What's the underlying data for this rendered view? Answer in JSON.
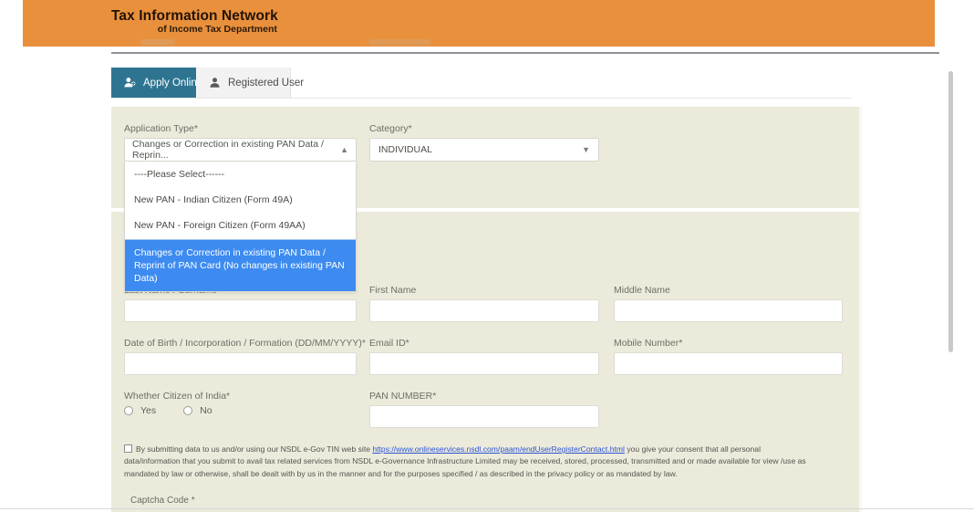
{
  "header": {
    "brand_line1": "Tax Information Network",
    "brand_line2": "of Income Tax Department",
    "background_color": "#e8903c"
  },
  "tabs": [
    {
      "label": "Apply Online",
      "icon": "user-add-icon",
      "active": true,
      "active_color": "#2e7491"
    },
    {
      "label": "Registered User",
      "icon": "user-icon",
      "active": false
    }
  ],
  "form": {
    "application_type": {
      "label": "Application Type*",
      "selected": "Changes or Correction in existing PAN Data / Reprin...",
      "expanded": true,
      "options": [
        "----Please Select------",
        "New PAN - Indian Citizen (Form 49A)",
        "New PAN - Foreign Citizen (Form 49AA)",
        "Changes or Correction in existing PAN Data / Reprint of PAN Card (No changes in existing PAN Data)"
      ],
      "highlighted_index": 3,
      "highlight_color": "#3d8bf0"
    },
    "category": {
      "label": "Category*",
      "selected": "INDIVIDUAL"
    },
    "last_name": {
      "label": "Last Name / Surname*",
      "value": ""
    },
    "first_name": {
      "label": "First Name",
      "value": ""
    },
    "middle_name": {
      "label": "Middle Name",
      "value": ""
    },
    "dob": {
      "label": "Date of Birth / Incorporation / Formation (DD/MM/YYYY)*",
      "value": ""
    },
    "email": {
      "label": "Email ID*",
      "value": ""
    },
    "mobile": {
      "label": "Mobile Number*",
      "value": ""
    },
    "citizen": {
      "label": "Whether Citizen of India*",
      "options": [
        "Yes",
        "No"
      ],
      "selected": ""
    },
    "pan_number": {
      "label": "PAN NUMBER*",
      "value": ""
    },
    "consent": {
      "text_before_link": "By submitting data to us and/or using our NSDL e-Gov TIN web site ",
      "link_text": "https://www.onlineservices.nsdl.com/paam/endUserRegisterContact.html",
      "text_after_link": " you give your consent that all personal data/information that you submit to avail tax related services from NSDL e-Governance Infrastructure Limited may be received, stored, processed, transmitted and or made available for view /use as mandated by law or otherwise, shall be dealt with by us in the manner and for the purposes specified / as described in the privacy policy or as mandated by law.",
      "checked": false,
      "link_color": "#2a56d4"
    },
    "captcha": {
      "label": "Captcha Code *"
    }
  }
}
